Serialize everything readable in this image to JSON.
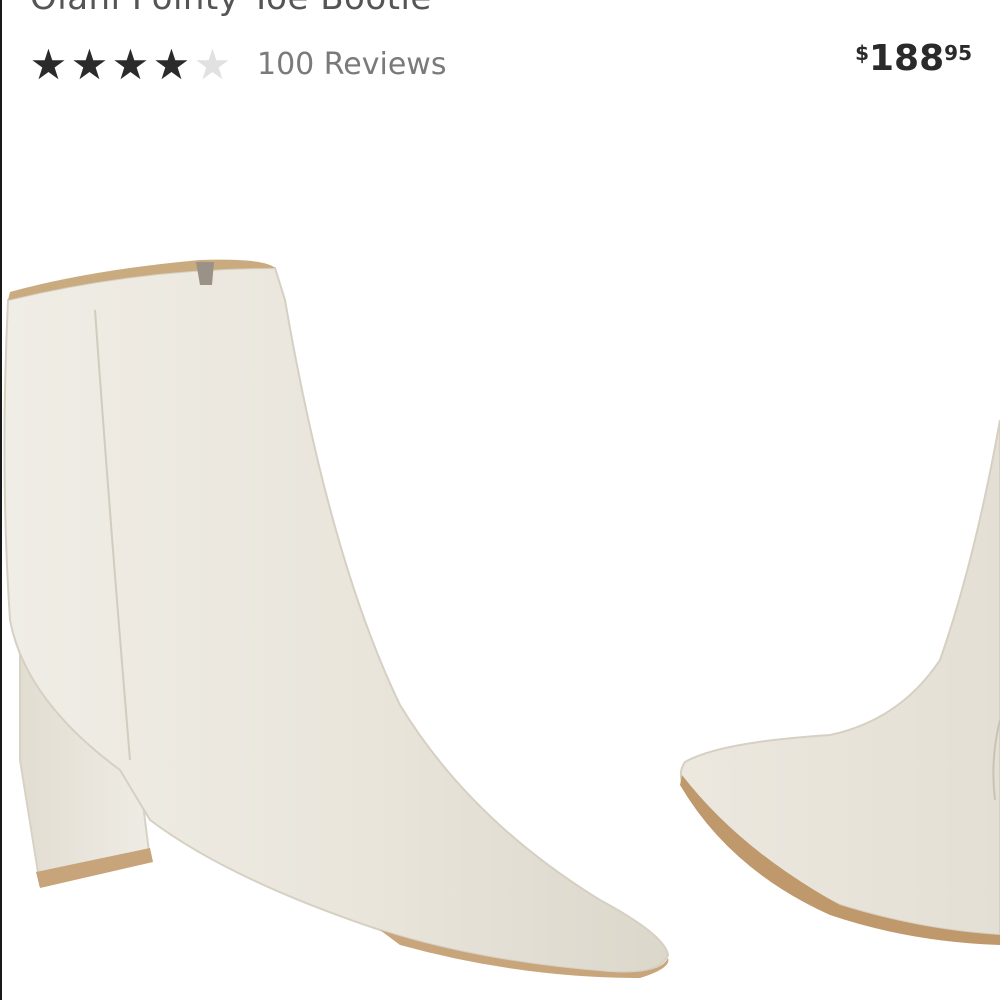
{
  "product": {
    "title": "Olani Pointy Toe Bootie",
    "rating": {
      "value": 4,
      "max": 5,
      "reviews_label": "100 Reviews"
    },
    "price": {
      "currency": "$",
      "whole": "188",
      "cents": "95"
    },
    "image": {
      "subject": "ivory leather pointy toe ankle boots, pair"
    }
  },
  "colors": {
    "leather": "#e9e5db",
    "leather_shadow": "#d6d0c3",
    "lining": "#c9ab7f",
    "sole": "#b99065",
    "star_filled": "#2b2b2b",
    "star_empty": "#e1e1e1",
    "text_muted": "#7a7a7a"
  }
}
